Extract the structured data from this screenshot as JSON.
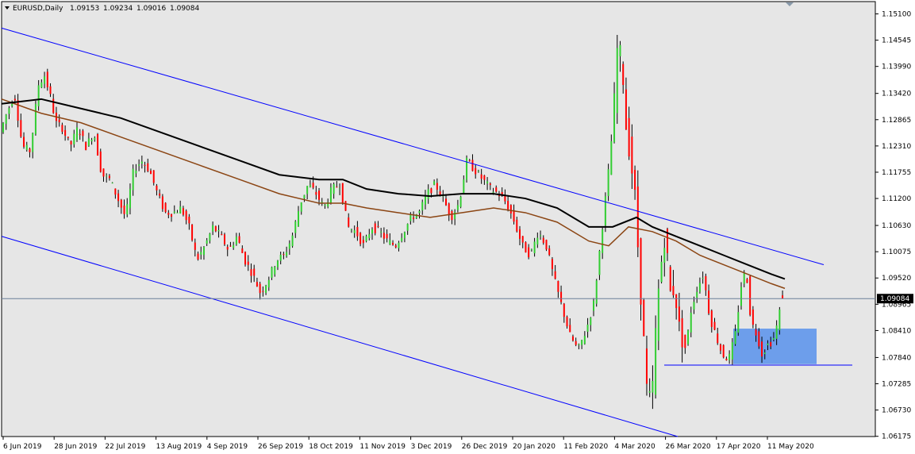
{
  "header": {
    "symbol_timeframe": "EURUSD,Daily",
    "open": "1.09153",
    "high": "1.09234",
    "low": "1.09016",
    "close": "1.09084"
  },
  "colors": {
    "plot_bg": "#e6e6e6",
    "bull": "#32cd32",
    "bear": "#ff0000",
    "wick": "#000000",
    "channel": "#0000ff",
    "ma_slow": "#000000",
    "ma_fast": "#8b4513",
    "bid_line": "#6a7f98",
    "zone": "#6d9eeb"
  },
  "chart_data": {
    "type": "candlestick",
    "title": "EURUSD,Daily",
    "ylim": [
      1.0617,
      1.1536
    ],
    "price_ticks": [
      "1.15100",
      "1.14545",
      "1.13990",
      "1.13420",
      "1.12865",
      "1.12310",
      "1.11755",
      "1.11200",
      "1.10630",
      "1.10075",
      "1.09520",
      "1.08965",
      "1.08410",
      "1.07840",
      "1.07285",
      "1.06730",
      "1.06175"
    ],
    "date_ticks": [
      "6 Jun 2019",
      "28 Jun 2019",
      "22 Jul 2019",
      "13 Aug 2019",
      "4 Sep 2019",
      "26 Sep 2019",
      "18 Oct 2019",
      "11 Nov 2019",
      "3 Dec 2019",
      "26 Dec 2019",
      "20 Jan 2020",
      "11 Feb 2020",
      "4 Mar 2020",
      "26 Mar 2020",
      "17 Apr 2020",
      "11 May 2020"
    ],
    "current_price": "1.09084",
    "close_path": [
      [
        0,
        1.125
      ],
      [
        10,
        1.13
      ],
      [
        20,
        1.134
      ],
      [
        30,
        1.123
      ],
      [
        40,
        1.122
      ],
      [
        50,
        1.136
      ],
      [
        58,
        1.138
      ],
      [
        66,
        1.133
      ],
      [
        72,
        1.128
      ],
      [
        80,
        1.127
      ],
      [
        90,
        1.123
      ],
      [
        100,
        1.127
      ],
      [
        110,
        1.123
      ],
      [
        120,
        1.126
      ],
      [
        130,
        1.117
      ],
      [
        140,
        1.116
      ],
      [
        150,
        1.112
      ],
      [
        160,
        1.108
      ],
      [
        170,
        1.118
      ],
      [
        180,
        1.12
      ],
      [
        190,
        1.118
      ],
      [
        200,
        1.113
      ],
      [
        210,
        1.109
      ],
      [
        220,
        1.109
      ],
      [
        230,
        1.11
      ],
      [
        240,
        1.106
      ],
      [
        250,
        1.099
      ],
      [
        260,
        1.102
      ],
      [
        270,
        1.106
      ],
      [
        280,
        1.104
      ],
      [
        290,
        1.101
      ],
      [
        300,
        1.104
      ],
      [
        310,
        1.099
      ],
      [
        320,
        1.096
      ],
      [
        330,
        1.092
      ],
      [
        340,
        1.095
      ],
      [
        350,
        1.099
      ],
      [
        360,
        1.1
      ],
      [
        370,
        1.104
      ],
      [
        380,
        1.111
      ],
      [
        390,
        1.115
      ],
      [
        400,
        1.113
      ],
      [
        410,
        1.11
      ],
      [
        420,
        1.114
      ],
      [
        430,
        1.115
      ],
      [
        440,
        1.106
      ],
      [
        450,
        1.105
      ],
      [
        460,
        1.102
      ],
      [
        470,
        1.106
      ],
      [
        480,
        1.105
      ],
      [
        490,
        1.103
      ],
      [
        500,
        1.102
      ],
      [
        510,
        1.105
      ],
      [
        520,
        1.108
      ],
      [
        530,
        1.109
      ],
      [
        540,
        1.113
      ],
      [
        550,
        1.115
      ],
      [
        560,
        1.112
      ],
      [
        570,
        1.108
      ],
      [
        580,
        1.111
      ],
      [
        590,
        1.12
      ],
      [
        600,
        1.118
      ],
      [
        610,
        1.116
      ],
      [
        620,
        1.114
      ],
      [
        630,
        1.113
      ],
      [
        640,
        1.111
      ],
      [
        650,
        1.107
      ],
      [
        660,
        1.102
      ],
      [
        670,
        1.1
      ],
      [
        680,
        1.105
      ],
      [
        690,
        1.102
      ],
      [
        700,
        1.095
      ],
      [
        710,
        1.089
      ],
      [
        720,
        1.083
      ],
      [
        730,
        1.08
      ],
      [
        740,
        1.084
      ],
      [
        750,
        1.09
      ],
      [
        760,
        1.105
      ],
      [
        770,
        1.12
      ],
      [
        775,
        1.13
      ],
      [
        780,
        1.145
      ],
      [
        786,
        1.14
      ],
      [
        790,
        1.128
      ],
      [
        796,
        1.121
      ],
      [
        802,
        1.112
      ],
      [
        808,
        1.095
      ],
      [
        814,
        1.079
      ],
      [
        818,
        1.068
      ],
      [
        824,
        1.072
      ],
      [
        830,
        1.09
      ],
      [
        836,
        1.1
      ],
      [
        840,
        1.105
      ],
      [
        846,
        1.092
      ],
      [
        852,
        1.093
      ],
      [
        858,
        1.084
      ],
      [
        866,
        1.08
      ],
      [
        872,
        1.088
      ],
      [
        880,
        1.093
      ],
      [
        888,
        1.096
      ],
      [
        896,
        1.087
      ],
      [
        904,
        1.083
      ],
      [
        912,
        1.079
      ],
      [
        920,
        1.078
      ],
      [
        928,
        1.083
      ],
      [
        936,
        1.094
      ],
      [
        942,
        1.097
      ],
      [
        948,
        1.086
      ],
      [
        956,
        1.083
      ],
      [
        962,
        1.079
      ],
      [
        968,
        1.081
      ],
      [
        976,
        1.082
      ],
      [
        982,
        1.086
      ],
      [
        987,
        1.0908
      ]
    ],
    "channel_upper": [
      [
        0,
        1.148
      ],
      [
        1036,
        1.098
      ]
    ],
    "channel_lower": [
      [
        0,
        1.104
      ],
      [
        852,
        1.0617
      ]
    ],
    "ma_slow": [
      [
        0,
        1.132
      ],
      [
        50,
        1.133
      ],
      [
        100,
        1.131
      ],
      [
        150,
        1.129
      ],
      [
        200,
        1.126
      ],
      [
        250,
        1.123
      ],
      [
        300,
        1.12
      ],
      [
        350,
        1.117
      ],
      [
        400,
        1.116
      ],
      [
        430,
        1.116
      ],
      [
        460,
        1.114
      ],
      [
        500,
        1.113
      ],
      [
        540,
        1.1125
      ],
      [
        580,
        1.113
      ],
      [
        620,
        1.113
      ],
      [
        660,
        1.112
      ],
      [
        700,
        1.11
      ],
      [
        740,
        1.106
      ],
      [
        770,
        1.106
      ],
      [
        800,
        1.108
      ],
      [
        820,
        1.106
      ],
      [
        850,
        1.104
      ],
      [
        880,
        1.102
      ],
      [
        910,
        1.1
      ],
      [
        940,
        1.098
      ],
      [
        970,
        1.096
      ],
      [
        987,
        1.095
      ]
    ],
    "ma_fast": [
      [
        0,
        1.133
      ],
      [
        50,
        1.13
      ],
      [
        100,
        1.128
      ],
      [
        150,
        1.125
      ],
      [
        200,
        1.122
      ],
      [
        250,
        1.119
      ],
      [
        300,
        1.116
      ],
      [
        350,
        1.113
      ],
      [
        400,
        1.111
      ],
      [
        430,
        1.111
      ],
      [
        460,
        1.11
      ],
      [
        500,
        1.109
      ],
      [
        540,
        1.108
      ],
      [
        580,
        1.109
      ],
      [
        620,
        1.11
      ],
      [
        660,
        1.109
      ],
      [
        700,
        1.107
      ],
      [
        740,
        1.103
      ],
      [
        765,
        1.102
      ],
      [
        790,
        1.106
      ],
      [
        820,
        1.105
      ],
      [
        850,
        1.103
      ],
      [
        880,
        1.1
      ],
      [
        910,
        1.098
      ],
      [
        940,
        1.096
      ],
      [
        970,
        1.094
      ],
      [
        987,
        1.093
      ]
    ],
    "support_line": {
      "x_from": 835,
      "x_to": 1072,
      "price": 1.0768
    },
    "demand_zone": {
      "x_from": 922,
      "x_to": 1027,
      "price_top": 1.0845,
      "price_bottom": 1.077
    }
  }
}
